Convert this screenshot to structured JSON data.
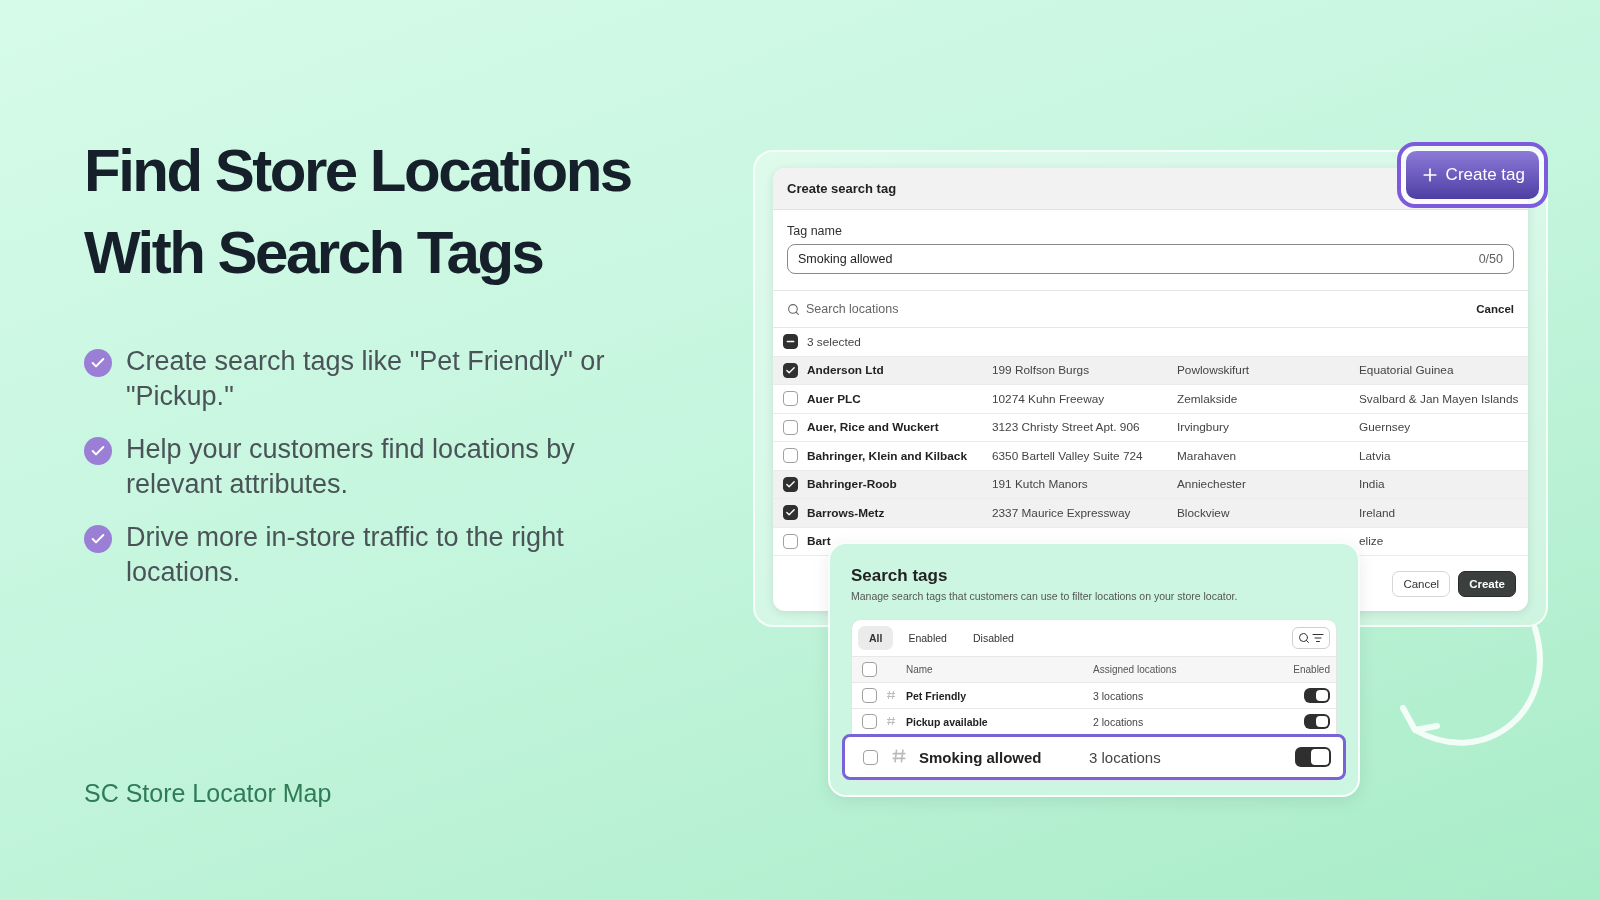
{
  "headline": "Find Store Locations With Search Tags",
  "features": [
    "Create search tags like \"Pet Friendly\" or \"Pickup.\"",
    "Help your customers find locations by relevant attributes.",
    "Drive more in-store traffic to the right locations."
  ],
  "brand": "SC Store Locator Map",
  "create_tag_button": "Create tag",
  "dialog": {
    "title": "Create search tag",
    "tag_name_label": "Tag name",
    "tag_name_value": "Smoking allowed",
    "counter": "0/50",
    "search_placeholder": "Search locations",
    "search_cancel": "Cancel",
    "selection_label": "3 selected",
    "indeterminate": true,
    "rows": [
      {
        "name": "Anderson Ltd",
        "address": "199 Rolfson Burgs",
        "city": "Powlowskifurt",
        "country": "Equatorial Guinea",
        "selected": true
      },
      {
        "name": "Auer PLC",
        "address": "10274 Kuhn Freeway",
        "city": "Zemlakside",
        "country": "Svalbard & Jan Mayen Islands",
        "selected": false
      },
      {
        "name": "Auer, Rice and Wuckert",
        "address": "3123 Christy Street Apt. 906",
        "city": "Irvingbury",
        "country": "Guernsey",
        "selected": false
      },
      {
        "name": "Bahringer, Klein and Kilback",
        "address": "6350 Bartell Valley Suite 724",
        "city": "Marahaven",
        "country": "Latvia",
        "selected": false
      },
      {
        "name": "Bahringer-Roob",
        "address": "191 Kutch Manors",
        "city": "Anniechester",
        "country": "India",
        "selected": true
      },
      {
        "name": "Barrows-Metz",
        "address": "2337 Maurice Expressway",
        "city": "Blockview",
        "country": "Ireland",
        "selected": true
      },
      {
        "name": "Bart",
        "country": "elize",
        "selected": false
      }
    ],
    "buttons": [
      "Cancel",
      "Create"
    ]
  },
  "search_tags": {
    "title": "Search tags",
    "description": "Manage search tags that customers can use to filter locations on your store locator.",
    "tabs": [
      {
        "label": "All",
        "selected": true
      },
      {
        "label": "Enabled",
        "selected": false
      },
      {
        "label": "Disabled",
        "selected": false
      }
    ],
    "columns": [
      "Name",
      "Assigned locations",
      "Enabled"
    ],
    "all_checked": false,
    "rows": [
      {
        "name": "Pet Friendly",
        "count": "3 locations",
        "checked": false,
        "enabled": true,
        "highlighted": false
      },
      {
        "name": "Pickup available",
        "count": "2 locations",
        "checked": false,
        "enabled": true,
        "highlighted": false
      },
      {
        "name": "Smoking allowed",
        "count": "3 locations",
        "checked": false,
        "enabled": true,
        "highlighted": true
      }
    ]
  }
}
